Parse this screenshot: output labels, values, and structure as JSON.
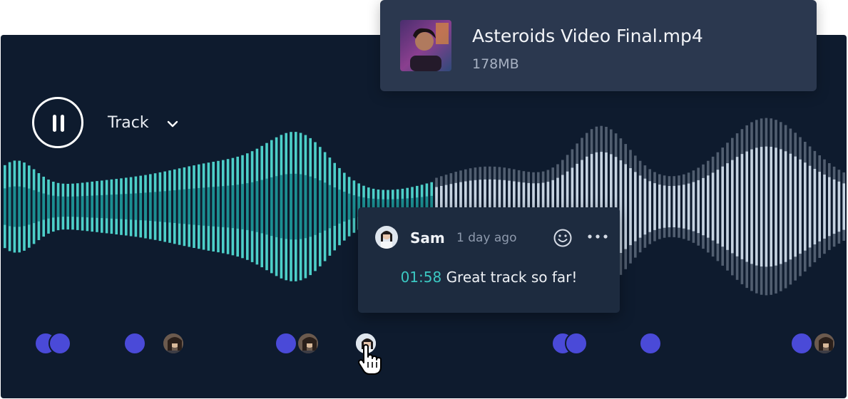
{
  "player": {
    "pause_label": "pause",
    "track_label": "Track",
    "chevron_icon": "chevron-down-icon"
  },
  "file": {
    "name": "Asteroids Video Final.mp4",
    "size": "178MB"
  },
  "comment": {
    "author": "Sam",
    "time": "1 day ago",
    "timestamp": "01:58",
    "text": "Great track so far!"
  },
  "colors": {
    "background": "#0e1b2e",
    "played": "#4dcfc9",
    "unplayed": "#c6d3e1",
    "marker": "#4a4ad8",
    "timestamp": "#3bc8c2"
  },
  "waveform": {
    "played_fraction": 0.51
  }
}
